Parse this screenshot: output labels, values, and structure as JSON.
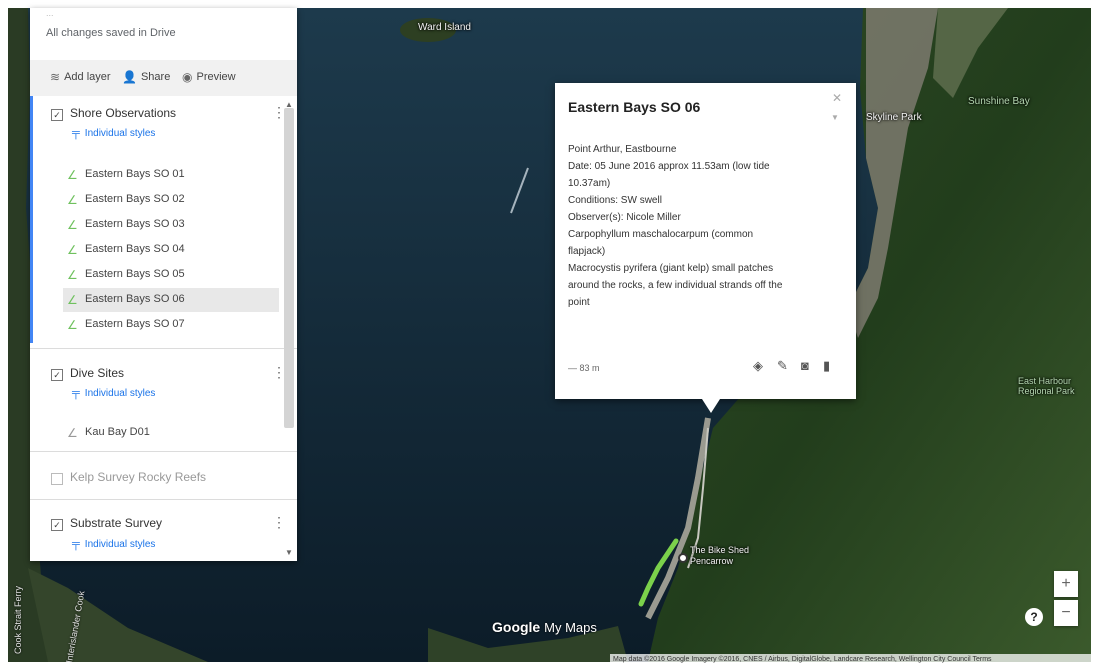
{
  "panel": {
    "top_faint": "...",
    "saved_status": "All changes saved in Drive",
    "toolbar": {
      "add_layer": "Add layer",
      "share": "Share",
      "preview": "Preview"
    },
    "layers": [
      {
        "name": "Shore Observations",
        "checked": true,
        "styles_label": "Individual styles",
        "items": [
          "Eastern Bays SO 01",
          "Eastern Bays SO 02",
          "Eastern Bays SO 03",
          "Eastern Bays SO 04",
          "Eastern Bays SO 05",
          "Eastern Bays SO 06",
          "Eastern Bays SO 07"
        ],
        "selected_item": "Eastern Bays SO 06"
      },
      {
        "name": "Dive Sites",
        "checked": true,
        "styles_label": "Individual styles",
        "items": [
          "Kau Bay D01"
        ]
      },
      {
        "name": "Kelp Survey Rocky Reefs",
        "checked": false
      },
      {
        "name": "Substrate Survey",
        "checked": true,
        "styles_label": "Individual styles"
      }
    ]
  },
  "info_window": {
    "title": "Eastern Bays SO 06",
    "description_lines": [
      "Point Arthur, Eastbourne",
      "Date: 05 June 2016 approx 11.53am (low tide",
      "10.37am)",
      "Conditions: SW swell",
      "Observer(s): Nicole Miller",
      "Carpophyllum maschalocarpum (common",
      "flapjack)",
      "Macrocystis pyrifera (giant kelp) small patches",
      "around the rocks, a few individual strands off the",
      "point"
    ],
    "distance": "— 83 m"
  },
  "map": {
    "place_labels": {
      "island": "Ward Island",
      "area_top_right": "Skyline Park",
      "area_right": "Sunshine Bay",
      "reserve": "East Harbour Regional Park",
      "bike_shed": "The Bike Shed Pencarrow"
    },
    "road_labels": [
      "Cook Strait Ferry",
      "Interislander Cook"
    ],
    "zoom_in": "+",
    "zoom_out": "−",
    "help": "?",
    "logo_google": "Google",
    "logo_mymaps": "My Maps",
    "attribution": "Map data ©2016 Google Imagery ©2016, CNES / Airbus, DigitalGlobe, Landcare Research, Wellington City Council   Terms"
  },
  "colors": {
    "accent_blue": "#4285f4",
    "layer_marker_green": "#6fc15e",
    "route_green": "#7bd14b"
  }
}
